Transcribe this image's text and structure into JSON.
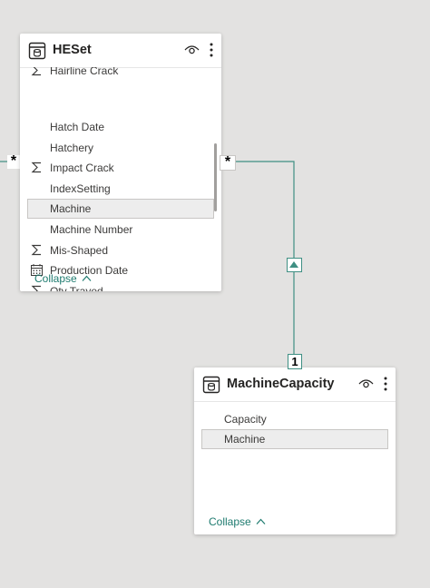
{
  "tables": {
    "heset": {
      "title": "HESet",
      "fields": [
        {
          "label": "Hairline Crack",
          "icon": "sigma-icon"
        },
        {
          "label": "Hatch Date",
          "icon": ""
        },
        {
          "label": "Hatchery",
          "icon": ""
        },
        {
          "label": "Impact Crack",
          "icon": "sigma-icon"
        },
        {
          "label": "IndexSetting",
          "icon": ""
        },
        {
          "label": "Machine",
          "icon": "",
          "selected": true
        },
        {
          "label": "Machine Number",
          "icon": ""
        },
        {
          "label": "Mis-Shaped",
          "icon": "sigma-icon"
        },
        {
          "label": "Production Date",
          "icon": "calendar-icon"
        },
        {
          "label": "Qty Trayed",
          "icon": "sigma-icon"
        }
      ],
      "collapse_label": "Collapse"
    },
    "machine_capacity": {
      "title": "MachineCapacity",
      "fields": [
        {
          "label": "Capacity",
          "icon": ""
        },
        {
          "label": "Machine",
          "icon": "",
          "selected": true
        }
      ],
      "collapse_label": "Collapse"
    }
  },
  "relationship": {
    "many_marker": "*",
    "one_marker": "1",
    "left_marker": "*"
  },
  "colors": {
    "accent": "#1e7b6f",
    "canvas": "#e3e2e1",
    "card": "#ffffff"
  }
}
